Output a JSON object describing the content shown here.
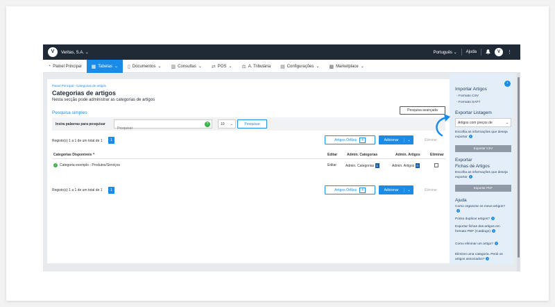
{
  "topbar": {
    "logo": "V",
    "company": "Veritas, S.A.",
    "language": "Português",
    "help": "Ajuda",
    "avatar": "V"
  },
  "menu": [
    {
      "label": "Painel Principal",
      "icon": "gauge-icon"
    },
    {
      "label": "Tabelas",
      "icon": "table-icon",
      "active": true
    },
    {
      "label": "Documentos",
      "icon": "document-icon"
    },
    {
      "label": "Consultas",
      "icon": "chart-icon"
    },
    {
      "label": "POS",
      "icon": "pos-icon"
    },
    {
      "label": "A. Tributária",
      "icon": "tax-icon"
    },
    {
      "label": "Configurações",
      "icon": "settings-icon"
    },
    {
      "label": "Marketplace",
      "icon": "marketplace-icon"
    }
  ],
  "page": {
    "breadcrumb_home": "Painel Principal",
    "breadcrumb_sep": "›",
    "breadcrumb_current": "Categorias de artigos",
    "title": "Categorias de artigos",
    "subtitle": "Nesta secção pode administrar as categorias de artigos",
    "simple_search": "Pesquisa simples",
    "advanced_search": "Pesquisa avançada"
  },
  "search": {
    "label": "Insira palavras para pesquisar",
    "placeholder": "Pesquisar",
    "per_page": "10",
    "button": "Pesquisar"
  },
  "records": {
    "text": "Registo(s) 1 a 1 de um total de 1",
    "page": "1",
    "orphans_label": "Artigos Órfãos",
    "orphans_count": "4",
    "add_button": "Adicionar",
    "delete_button": "Eliminar"
  },
  "table": {
    "headers": [
      "Categorias Disponíveis ^",
      "Editar",
      "Admin. Categorias",
      "Admin. Artigos",
      "Eliminar"
    ],
    "rows": [
      {
        "name": "Categoria exemplo - Produtos/Serviços",
        "edit": "Editar",
        "admin_categories": "Admin. Categorias",
        "admin_categories_count": "1",
        "admin_articles": "Admin. Artigos",
        "admin_articles_count": "0"
      }
    ]
  },
  "sidebar": {
    "import_title": "Importar Artigos",
    "import_items": [
      "- Formato CSV",
      "- Formato SAFT"
    ],
    "export_list_title": "Exportar Listagem",
    "export_select": "Artigos com preços de",
    "export_hint": "Escolha as informações que deseja exportar",
    "export_csv": "Exportar CSV",
    "export_sheets_title_1": "Exportar",
    "export_sheets_title_2": "Fichas de Artigos",
    "export_sheets_hint": "Escolha as informações que deseja exportar",
    "export_pdf": "Exportar PDF",
    "help_title": "Ajuda",
    "help_items": [
      "Como organizar os meus artigos?",
      "Posso duplicar artigos?",
      "Exportar fichas dos artigos em formato PDF (Catálogo)",
      "Como eliminar um artigo?",
      "Eliminei uma categoria. Perdi os artigos associados?"
    ]
  },
  "colors": {
    "accent": "#1a8be6",
    "topbar": "#1f2a36",
    "sidebar": "#e3eef9"
  }
}
